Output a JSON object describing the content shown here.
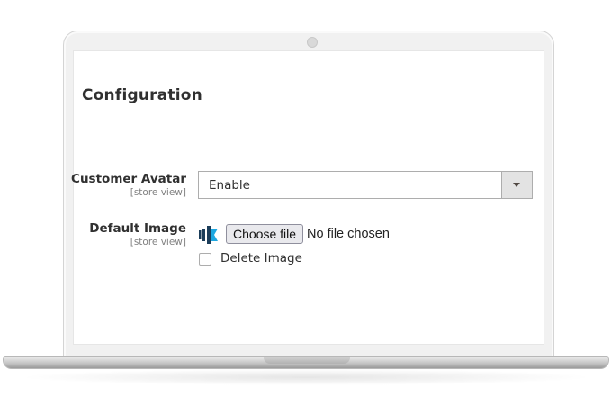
{
  "page": {
    "title": "Configuration"
  },
  "fields": {
    "customer_avatar": {
      "label": "Customer Avatar",
      "scope": "[store view]",
      "selected_value": "Enable"
    },
    "default_image": {
      "label": "Default Image",
      "scope": "[store view]",
      "choose_button_label": "Choose file",
      "file_status": "No file chosen",
      "delete_label": "Delete Image",
      "delete_checked": false
    }
  },
  "icons": {
    "thumbnail": "default-image-thumbnail-icon",
    "dropdown": "chevron-down-icon"
  },
  "colors": {
    "text": "#303030",
    "scope_text": "#808080",
    "icon_dark": "#1c3d5a",
    "icon_accent": "#1ea7e0"
  }
}
